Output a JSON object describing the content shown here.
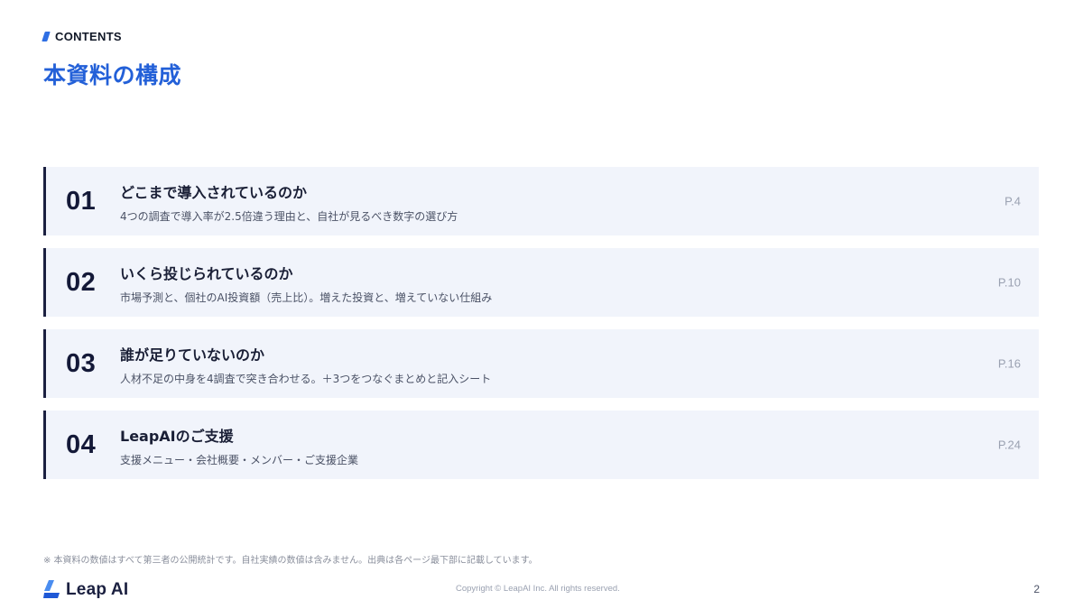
{
  "header": {
    "eyebrow": "CONTENTS",
    "title": "本資料の構成"
  },
  "toc": [
    {
      "number": "01",
      "title": "どこまで導入されているのか",
      "description": "4つの調査で導入率が2.5倍違う理由と、自社が見るべき数字の選び方",
      "page": "P.4"
    },
    {
      "number": "02",
      "title": "いくら投じられているのか",
      "description": "市場予測と、個社のAI投資額（売上比）。増えた投資と、増えていない仕組み",
      "page": "P.10"
    },
    {
      "number": "03",
      "title": "誰が足りていないのか",
      "description": "人材不足の中身を4調査で突き合わせる。＋3つをつなぐまとめと記入シート",
      "page": "P.16"
    },
    {
      "number": "04",
      "title": "LeapAIのご支援",
      "description": "支援メニュー・会社概要・メンバー・ご支援企業",
      "page": "P.24"
    }
  ],
  "footer": {
    "note": "※ 本資料の数値はすべて第三者の公開統計です。自社実績の数値は含みません。出典は各ページ最下部に記載しています。",
    "brand": "Leap AI",
    "copyright": "Copyright © LeapAI Inc. All rights reserved.",
    "page_number": "2"
  },
  "colors": {
    "accent": "#2360d8",
    "navy": "#1b2040",
    "row_bg": "#f1f4fb"
  },
  "icons": {
    "eyebrow": "slash-mark-icon",
    "brand": "leap-ai-logo-icon"
  }
}
